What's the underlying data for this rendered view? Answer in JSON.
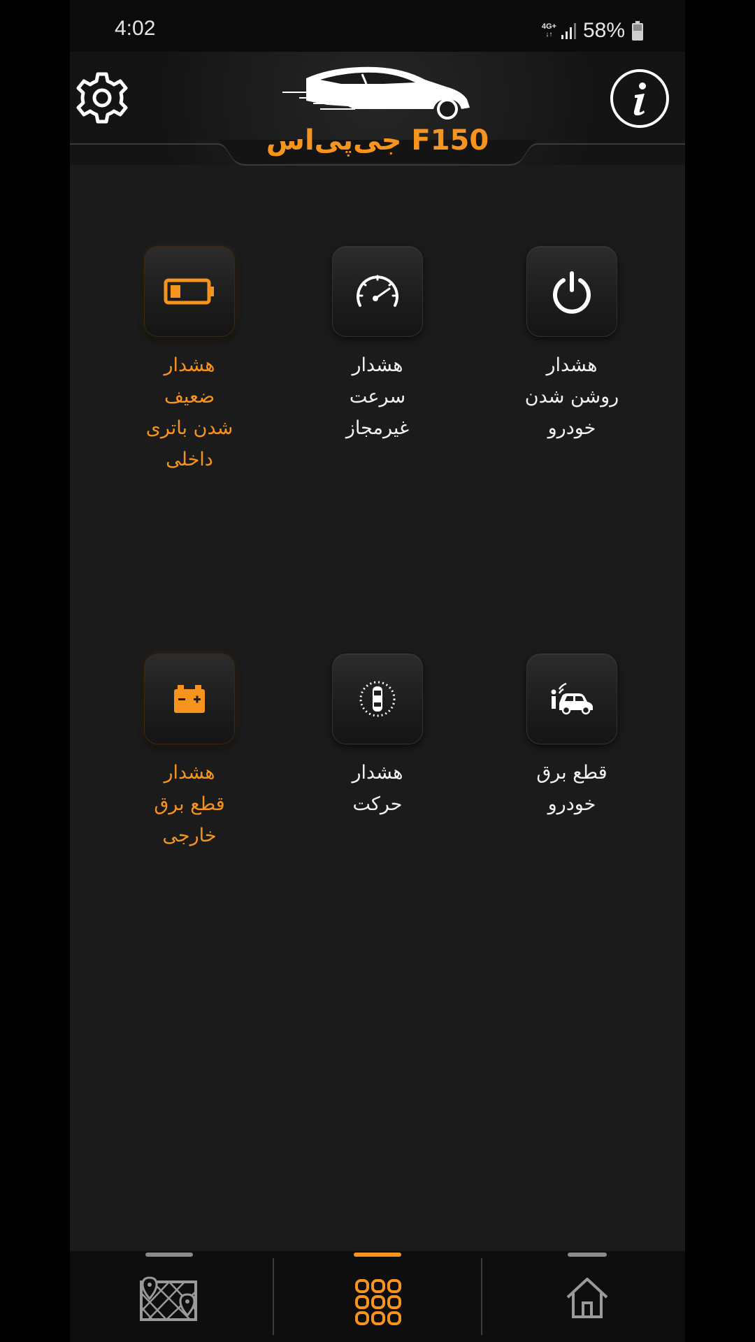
{
  "status_bar": {
    "time": "4:02",
    "network_type": "4G+",
    "battery_percent": "58%"
  },
  "header": {
    "title": "جی‌پی‌اس F150",
    "accent_color": "#f7941d"
  },
  "tiles": [
    {
      "icon": "power-icon",
      "lines": [
        "هشدار",
        "روشن شدن",
        "خودرو"
      ],
      "active": false
    },
    {
      "icon": "speedometer-icon",
      "lines": [
        "هشدار",
        "سرعت",
        "غیرمجاز"
      ],
      "active": false
    },
    {
      "icon": "battery-low-icon",
      "lines": [
        "هشدار",
        "ضعیف",
        "شدن باتری",
        "داخلی"
      ],
      "active": true
    },
    {
      "icon": "car-power-cut-icon",
      "lines": [
        "قطع برق",
        "خودرو"
      ],
      "active": false
    },
    {
      "icon": "car-motion-icon",
      "lines": [
        "هشدار",
        "حرکت"
      ],
      "active": false
    },
    {
      "icon": "car-battery-icon",
      "lines": [
        "هشدار",
        "قطع برق",
        "خارجی"
      ],
      "active": true
    }
  ],
  "bottom_nav": {
    "items": [
      {
        "icon": "map-icon",
        "active": false
      },
      {
        "icon": "grid-icon",
        "active": true
      },
      {
        "icon": "home-icon",
        "active": false
      }
    ]
  }
}
